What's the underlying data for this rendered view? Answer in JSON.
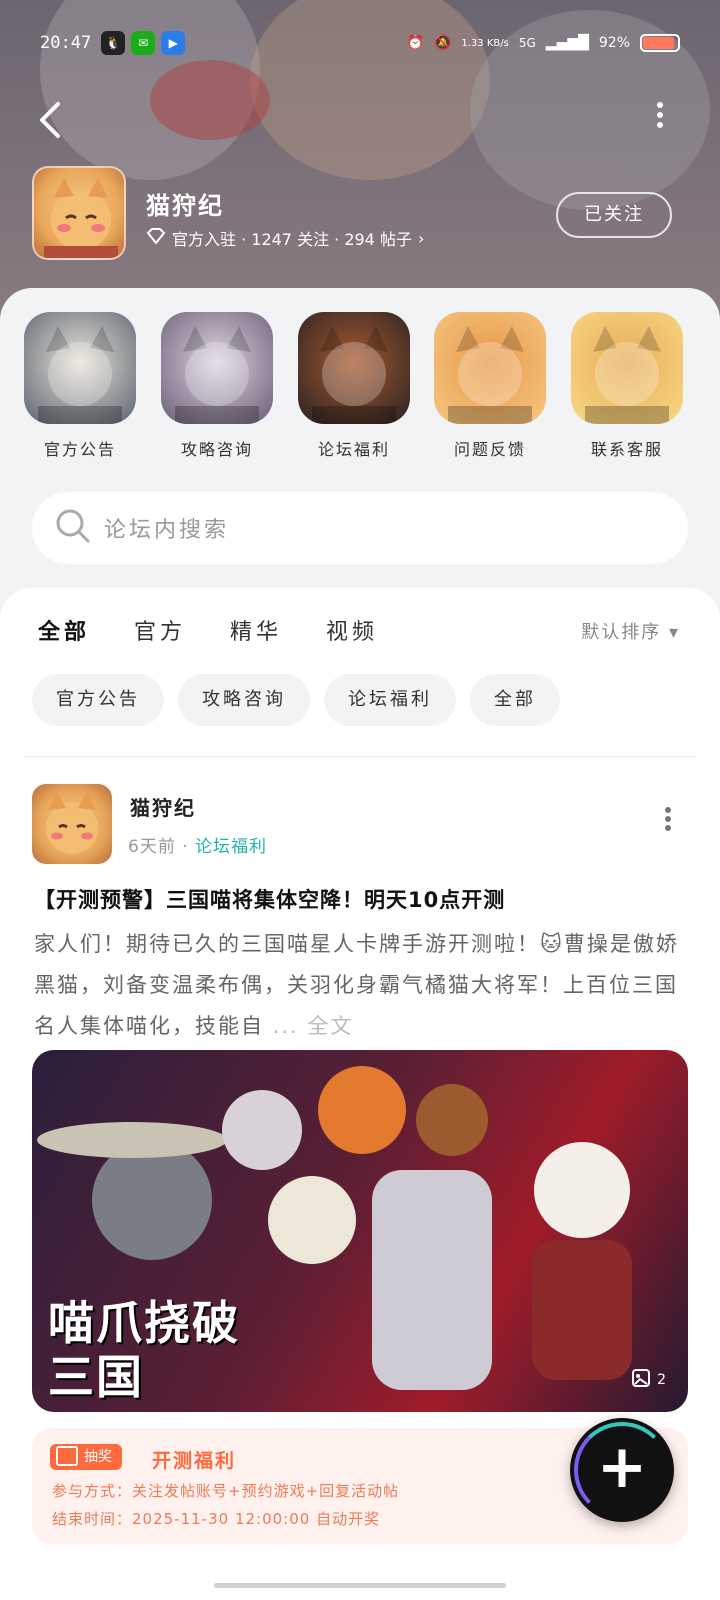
{
  "status_bar": {
    "time": "20:47",
    "net_speed": "1.33 KB/s",
    "network": "5G",
    "battery": "92%",
    "battery_level": 0.92
  },
  "forum": {
    "name": "猫狩纪",
    "meta": "官方入驻 · 1247 关注 · 294 帖子",
    "follow_label": "已关注"
  },
  "shortcuts": [
    {
      "label": "官方公告",
      "colors": [
        "#6f7780",
        "#e8e2d8"
      ]
    },
    {
      "label": "攻略咨询",
      "colors": [
        "#7b6f86",
        "#ddd4e0"
      ]
    },
    {
      "label": "论坛福利",
      "colors": [
        "#3a2a26",
        "#a85a2e"
      ]
    },
    {
      "label": "问题反馈",
      "colors": [
        "#f3c07a",
        "#e89a4a"
      ]
    },
    {
      "label": "联系客服",
      "colors": [
        "#f6d27e",
        "#e7ad5a"
      ]
    }
  ],
  "search": {
    "placeholder": "论坛内搜索"
  },
  "tabs": [
    "全部",
    "官方",
    "精华",
    "视频"
  ],
  "sort_label": "默认排序",
  "chips": [
    "官方公告",
    "攻略咨询",
    "论坛福利",
    "全部"
  ],
  "post": {
    "author": "猫狩纪",
    "time": "6天前",
    "tag": "论坛福利",
    "title": "【开测预警】三国喵将集体空降！明天10点开测",
    "body": "家人们！期待已久的三国喵星人卡牌手游开测啦！🐱曹操是傲娇黑猫，刘备变温柔布偶，关羽化身霸气橘猫大将军！上百位三国名人集体喵化，技能自",
    "more_label": "... 全文",
    "image_count": "2",
    "image_text": "喵爪挠破三国"
  },
  "promo": {
    "badge": "抽奖",
    "title": "开测福利",
    "line1": "参与方式：关注发帖账号+预约游戏+回复活动帖",
    "line2": "结束时间：2025-11-30 12:00:00 自动开奖"
  }
}
